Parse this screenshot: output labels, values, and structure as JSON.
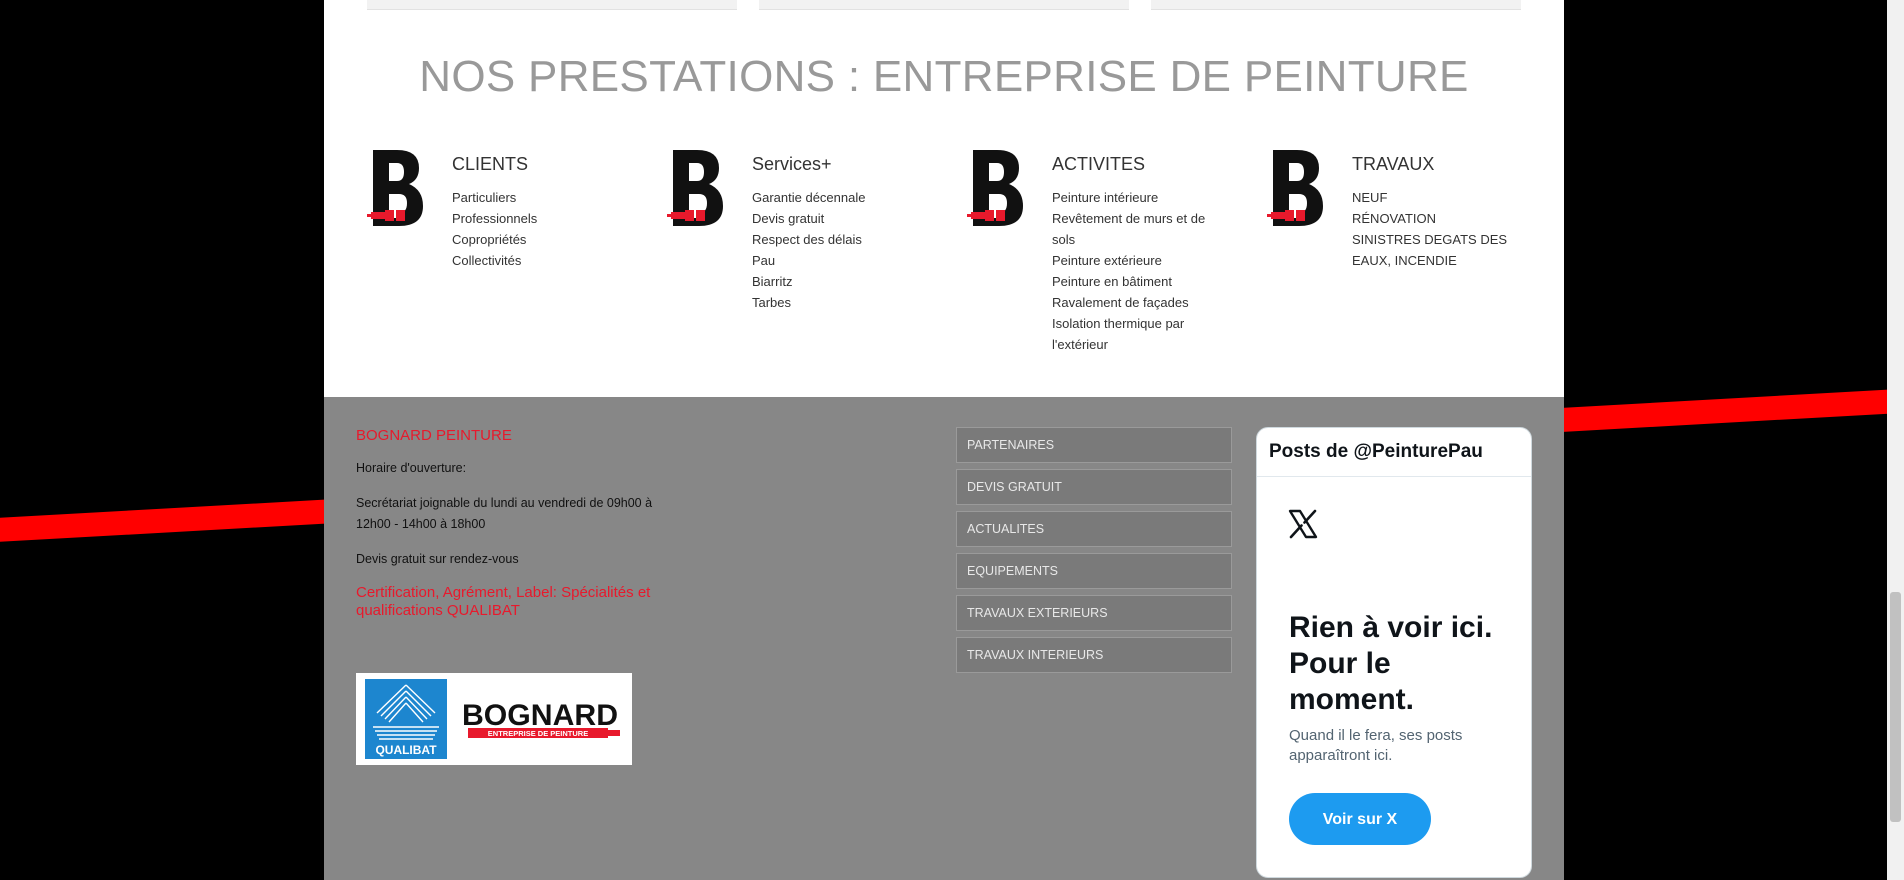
{
  "services": {
    "title": "NOS PRESTATIONS : ENTREPRISE DE PEINTURE",
    "columns": [
      {
        "title": "CLIENTS",
        "items": [
          "Particuliers",
          "Professionnels",
          "Copropriétés",
          "Collectivités"
        ]
      },
      {
        "title": "Services+",
        "items": [
          "Garantie décennale",
          "Devis gratuit",
          "Respect des délais",
          "Pau",
          "Biarritz",
          "Tarbes"
        ]
      },
      {
        "title": "ACTIVITES",
        "items": [
          "Peinture intérieure",
          "Revêtement de murs et de sols",
          "Peinture extérieure",
          "Peinture en bâtiment",
          "Ravalement de façades",
          "Isolation thermique par l'extérieur"
        ]
      },
      {
        "title": "TRAVAUX",
        "items": [
          "NEUF",
          "RÉNOVATION",
          "SINISTRES DEGATS DES EAUX, INCENDIE"
        ]
      }
    ],
    "icon": "bognard-b-brush-icon"
  },
  "footer": {
    "heading": "BOGNARD PEINTURE",
    "hours_label": "Horaire d'ouverture:",
    "hours_text": "Secrétariat joignable du lundi au vendredi de 09h00 à 12h00 - 14h00 à 18h00",
    "quote_text": "Devis gratuit sur rendez-vous",
    "cert_heading": "Certification, Agrément, Label: Spécialités et qualifications QUALIBAT",
    "logos": {
      "qualibat_text": "QUALIBAT",
      "bognard_text": "BOGNARD",
      "bognard_tagline": "ENTREPRISE DE PEINTURE"
    },
    "menu": [
      "PARTENAIRES",
      "DEVIS GRATUIT",
      "ACTUALITES",
      "EQUIPEMENTS",
      "TRAVAUX EXTERIEURS",
      "TRAVAUX INTERIEURS"
    ]
  },
  "twitter": {
    "header": "Posts de @PeinturePau",
    "empty_title": "Rien à voir ici. Pour le moment.",
    "empty_sub": "Quand il le fera, ses posts apparaîtront ici.",
    "button": "Voir sur X"
  },
  "colors": {
    "accent_red": "#e8192c",
    "stripe_red": "#ff0000",
    "twitter_blue": "#1d9bf0",
    "footer_gray": "#878787"
  }
}
